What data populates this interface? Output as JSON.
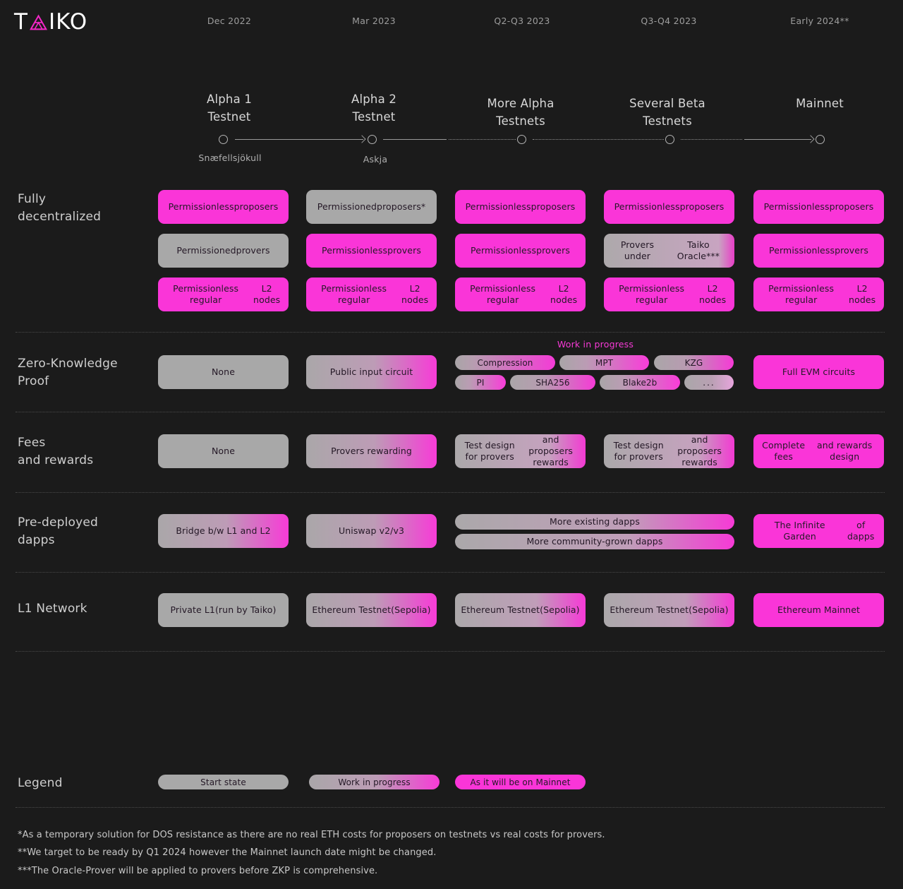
{
  "brand": {
    "logo_text_before": "T",
    "logo_mark": "taiko-triangle-logo",
    "logo_text_after": "IKO"
  },
  "timeline": {
    "columns": [
      {
        "date": "Dec 2022",
        "phase_line1": "Alpha 1",
        "phase_line2": "Testnet",
        "codename": "Snæfellsjökull"
      },
      {
        "date": "Mar 2023",
        "phase_line1": "Alpha 2",
        "phase_line2": "Testnet",
        "codename": "Askja"
      },
      {
        "date": "Q2-Q3 2023",
        "phase_line1": "More Alpha",
        "phase_line2": "Testnets",
        "codename": ""
      },
      {
        "date": "Q3-Q4 2023",
        "phase_line1": "Several Beta",
        "phase_line2": "Testnets",
        "codename": ""
      },
      {
        "date": "Early 2024**",
        "phase_line1": "Mainnet",
        "phase_line2": "",
        "codename": ""
      }
    ]
  },
  "rows": {
    "decentralized": {
      "label_line1": "Fully",
      "label_line2": "decentralized",
      "cells": {
        "a1_1": "Permissionless\nproposers",
        "a1_2": "Permissioned\nprovers",
        "a1_3": "Permissionless regular\nL2 nodes",
        "a2_1": "Permissioned\nproposers*",
        "a2_2": "Permissionless\nprovers",
        "a2_3": "Permissionless regular\nL2 nodes",
        "ma_1": "Permissionless\nproposers",
        "ma_2": "Permissionless\nprovers",
        "ma_3": "Permissionless regular\nL2 nodes",
        "bt_1": "Permissionless\nproposers",
        "bt_2": "Provers under\nTaiko Oracle***",
        "bt_3": "Permissionless regular\nL2 nodes",
        "mn_1": "Permissionless\nproposers",
        "mn_2": "Permissionless\nprovers",
        "mn_3": "Permissionless regular\nL2 nodes"
      }
    },
    "zkp": {
      "label_line1": "Zero-Knowledge",
      "label_line2": "Proof",
      "wip_label": "Work in progress",
      "cells": {
        "a1": "None",
        "a2": "Public input circuit",
        "mn": "Full EVM circuits"
      },
      "chips": [
        "Compression",
        "MPT",
        "KZG",
        "PI",
        "SHA256",
        "Blake2b",
        "..."
      ]
    },
    "fees": {
      "label_line1": "Fees",
      "label_line2": "and rewards",
      "cells": {
        "a1": "None",
        "a2": "Provers rewarding",
        "ma": "Test design for provers\nand proposers rewards",
        "bt": "Test design for provers\nand proposers rewards",
        "mn": "Complete fees\nand rewards design"
      }
    },
    "dapps": {
      "label_line1": "Pre-deployed",
      "label_line2": "dapps",
      "cells": {
        "a1": "Bridge b/w L1 and L2",
        "a2": "Uniswap v2/v3",
        "wide1": "More existing dapps",
        "wide2": "More community-grown dapps",
        "mn": "The Infinite Garden\nof dapps"
      }
    },
    "l1": {
      "label_line1": "L1 Network",
      "label_line2": "",
      "cells": {
        "a1": "Private L1\n(run by Taiko)",
        "a2": "Ethereum Testnet\n(Sepolia)",
        "ma": "Ethereum Testnet\n(Sepolia)",
        "bt": "Ethereum Testnet\n(Sepolia)",
        "mn": "Ethereum Mainnet"
      }
    }
  },
  "legend": {
    "label": "Legend",
    "items": [
      {
        "text": "Start state",
        "style": "gray"
      },
      {
        "text": "Work in progress",
        "style": "gradient"
      },
      {
        "text": "As it will be on Mainnet",
        "style": "pink"
      }
    ]
  },
  "footnotes": [
    "*As a temporary solution for DOS resistance as there are no real ETH costs for proposers on testnets vs real costs for provers.",
    "**We target to be ready by Q1 2024 however the Mainnet launch date might be changed.",
    "***The Oracle-Prover will be applied to provers before ZKP is comprehensive."
  ],
  "colors": {
    "background": "#1b1b1b",
    "pink": "#fa35d8",
    "gray": "#a8a8a8",
    "text": "#cfcfcf"
  }
}
